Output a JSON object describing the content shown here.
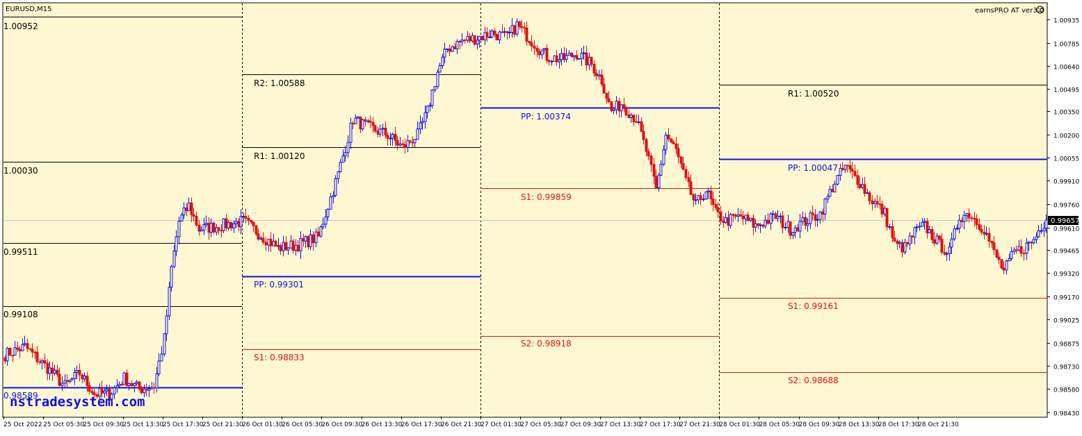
{
  "symbol_label": "EURUSD,M15",
  "indicator_label": "earnsPRO AT  ver3.0",
  "watermark": "nstradesystem.com",
  "colors": {
    "background": "#fef8d2",
    "bull": "#1010e6",
    "bear": "#e01010",
    "pivot": "#1010e6",
    "resistance": "#000000",
    "support": "#e01010",
    "current_line": "#c8c8c8",
    "price_box": "#000000"
  },
  "chart_data": {
    "type": "candlestick",
    "symbol": "EURUSD",
    "timeframe": "M15",
    "current_price": 0.99657,
    "current_price_label": "0.99657",
    "y_axis_ticks": [
      "1.00935",
      "1.00785",
      "1.00640",
      "1.00495",
      "1.00350",
      "1.00200",
      "1.00055",
      "0.99910",
      "0.99760",
      "0.99610",
      "0.99465",
      "0.99320",
      "0.99170",
      "0.99025",
      "0.98875",
      "0.98730",
      "0.98580",
      "0.98430"
    ],
    "ylim": [
      0.98405,
      1.01038
    ],
    "x_axis_labels": [
      "25 Oct 2022",
      "25 Oct 05:30",
      "25 Oct 09:30",
      "25 Oct 13:30",
      "25 Oct 17:30",
      "25 Oct 21:30",
      "26 Oct 01:30",
      "26 Oct 05:30",
      "26 Oct 09:30",
      "26 Oct 13:30",
      "26 Oct 17:30",
      "26 Oct 21:30",
      "27 Oct 01:30",
      "27 Oct 05:30",
      "27 Oct 09:30",
      "27 Oct 13:30",
      "27 Oct 17:30",
      "27 Oct 21:30",
      "28 Oct 01:30",
      "28 Oct 05:30",
      "28 Oct 09:30",
      "28 Oct 13:30",
      "28 Oct 17:30",
      "28 Oct 21:30"
    ],
    "sessions": [
      {
        "day": "25 Oct",
        "levels": [
          {
            "name": "",
            "value": 1.00952,
            "label": "1.00952",
            "kind": "resistance"
          },
          {
            "name": "",
            "value": 1.0003,
            "label": "1.00030",
            "kind": "resistance"
          },
          {
            "name": "",
            "value": 0.99511,
            "label": "0.99511",
            "kind": "resistance"
          },
          {
            "name": "",
            "value": 0.99108,
            "label": "0.99108",
            "kind": "resistance"
          },
          {
            "name": "",
            "value": 0.98589,
            "label": "0.98589",
            "kind": "pivot"
          }
        ]
      },
      {
        "day": "26 Oct",
        "levels": [
          {
            "name": "R2",
            "value": 1.00588,
            "label": "R2: 1.00588",
            "kind": "resistance"
          },
          {
            "name": "R1",
            "value": 1.0012,
            "label": "R1: 1.00120",
            "kind": "resistance"
          },
          {
            "name": "PP",
            "value": 0.99301,
            "label": "PP: 0.99301",
            "kind": "pivot"
          },
          {
            "name": "S1",
            "value": 0.98833,
            "label": "S1: 0.98833",
            "kind": "support"
          }
        ]
      },
      {
        "day": "27 Oct",
        "levels": [
          {
            "name": "PP",
            "value": 1.00374,
            "label": "PP: 1.00374",
            "kind": "pivot"
          },
          {
            "name": "S1",
            "value": 0.99859,
            "label": "S1: 0.99859",
            "kind": "support"
          },
          {
            "name": "S2",
            "value": 0.98918,
            "label": "S2: 0.98918",
            "kind": "support"
          }
        ]
      },
      {
        "day": "28 Oct",
        "levels": [
          {
            "name": "R1",
            "value": 1.0052,
            "label": "R1: 1.00520",
            "kind": "resistance"
          },
          {
            "name": "PP",
            "value": 1.00047,
            "label": "PP: 1.00047",
            "kind": "pivot"
          },
          {
            "name": "S1",
            "value": 0.99161,
            "label": "S1: 0.99161",
            "kind": "support"
          },
          {
            "name": "S2",
            "value": 0.98688,
            "label": "S2: 0.98688",
            "kind": "support"
          }
        ]
      }
    ],
    "close_path": [
      [
        0,
        0.988
      ],
      [
        8,
        0.9885
      ],
      [
        18,
        0.987
      ],
      [
        24,
        0.986
      ],
      [
        30,
        0.9868
      ],
      [
        36,
        0.9855
      ],
      [
        42,
        0.9855
      ],
      [
        48,
        0.9865
      ],
      [
        54,
        0.9858
      ],
      [
        60,
        0.986
      ],
      [
        64,
        0.989
      ],
      [
        67,
        0.9935
      ],
      [
        70,
        0.9965
      ],
      [
        74,
        0.9975
      ],
      [
        78,
        0.996
      ],
      [
        86,
        0.9962
      ],
      [
        96,
        0.9965
      ],
      [
        104,
        0.9955
      ],
      [
        110,
        0.9948
      ],
      [
        118,
        0.995
      ],
      [
        126,
        0.9955
      ],
      [
        130,
        0.9975
      ],
      [
        134,
        0.9995
      ],
      [
        140,
        1.003
      ],
      [
        146,
        1.0025
      ],
      [
        154,
        1.002
      ],
      [
        160,
        1.0012
      ],
      [
        166,
        1.002
      ],
      [
        170,
        1.0035
      ],
      [
        174,
        1.006
      ],
      [
        178,
        1.0075
      ],
      [
        184,
        1.008
      ],
      [
        190,
        1.0082
      ],
      [
        196,
        1.0085
      ],
      [
        202,
        1.0082
      ],
      [
        206,
        1.009
      ],
      [
        212,
        1.008
      ],
      [
        218,
        1.007
      ],
      [
        224,
        1.0068
      ],
      [
        230,
        1.0072
      ],
      [
        236,
        1.0065
      ],
      [
        240,
        1.0055
      ],
      [
        244,
        1.0035
      ],
      [
        248,
        1.004
      ],
      [
        254,
        1.003
      ],
      [
        258,
        1.001
      ],
      [
        262,
        0.9985
      ],
      [
        266,
        1.002
      ],
      [
        270,
        1.001
      ],
      [
        274,
        0.999
      ],
      [
        278,
        0.9975
      ],
      [
        282,
        0.9985
      ],
      [
        286,
        0.997
      ],
      [
        290,
        0.9965
      ],
      [
        296,
        0.9968
      ],
      [
        302,
        0.9962
      ],
      [
        310,
        0.9968
      ],
      [
        316,
        0.996
      ],
      [
        322,
        0.9965
      ],
      [
        328,
        0.997
      ],
      [
        334,
        0.999
      ],
      [
        338,
        1.0
      ],
      [
        344,
        0.999
      ],
      [
        348,
        0.998
      ],
      [
        354,
        0.997
      ],
      [
        358,
        0.995
      ],
      [
        362,
        0.9948
      ],
      [
        366,
        0.9958
      ],
      [
        370,
        0.9962
      ],
      [
        376,
        0.995
      ],
      [
        380,
        0.9945
      ],
      [
        384,
        0.9968
      ],
      [
        388,
        0.997
      ],
      [
        394,
        0.996
      ],
      [
        398,
        0.9945
      ],
      [
        402,
        0.9933
      ],
      [
        406,
        0.9945
      ],
      [
        410,
        0.9948
      ],
      [
        414,
        0.9953
      ],
      [
        417,
        0.9962
      ],
      [
        419,
        0.9966
      ]
    ]
  },
  "sessions_view": {
    "s25": [
      {
        "label": "1.00952"
      },
      {
        "label": "1.00030"
      },
      {
        "label": "0.99511"
      },
      {
        "label": "0.99108"
      },
      {
        "label": "0.98589"
      }
    ],
    "s26": [
      {
        "label": "R2: 1.00588"
      },
      {
        "label": "R1: 1.00120"
      },
      {
        "label": "PP: 0.99301"
      },
      {
        "label": "S1: 0.98833"
      }
    ],
    "s27": [
      {
        "label": "PP: 1.00374"
      },
      {
        "label": "S1: 0.99859"
      },
      {
        "label": "S2: 0.98918"
      }
    ],
    "s28": [
      {
        "label": "R1: 1.00520"
      },
      {
        "label": "PP: 1.00047"
      },
      {
        "label": "S1: 0.99161"
      },
      {
        "label": "S2: 0.98688"
      }
    ]
  }
}
